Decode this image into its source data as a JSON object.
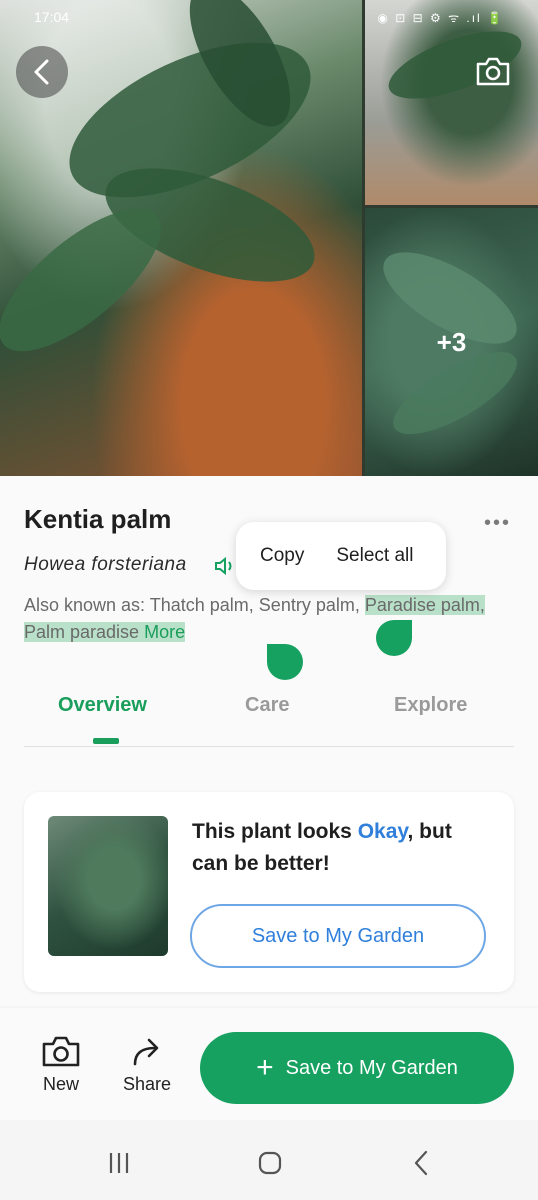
{
  "status_bar": {
    "time": "17:04",
    "icons": "◉ ⊡ ⊟        ⚙ ᯤ .ıl 🔋"
  },
  "gallery": {
    "more_count": "+3"
  },
  "plant": {
    "name": "Kentia palm",
    "scientific_name": "Howea forsteriana",
    "aka_label": "Also known as: ",
    "aka_plain": "Thatch palm, Sentry palm, ",
    "aka_selected": "Paradise palm, Palm paradise",
    "more_link": "More"
  },
  "context_menu": {
    "copy": "Copy",
    "select_all": "Select all"
  },
  "tabs": [
    {
      "label": "Overview"
    },
    {
      "label": "Care"
    },
    {
      "label": "Explore"
    }
  ],
  "health_card": {
    "message_prefix": "This plant looks ",
    "status": "Okay",
    "message_suffix": ", but can be better!",
    "button_label": "Save to My Garden"
  },
  "bottom_bar": {
    "new_label": "New",
    "share_label": "Share",
    "save_label": "Save to My Garden"
  },
  "colors": {
    "accent": "#16a160",
    "link": "#2f7fdb",
    "selection": "#b9e0c9"
  }
}
